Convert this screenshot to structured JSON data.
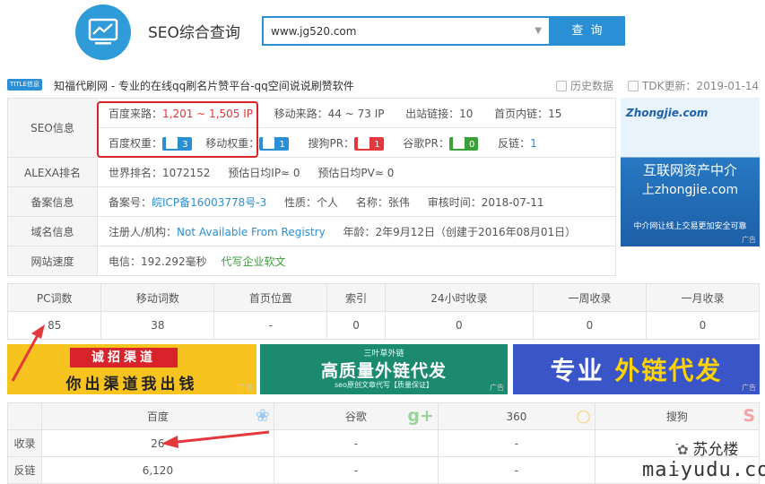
{
  "header": {
    "site_title": "SEO综合查询",
    "search_value": "www.jg520.com",
    "search_button": "查 询"
  },
  "title_bar": {
    "badge": "TITLE信息",
    "title": "知福代刷网 - 专业的在线qq刷名片赞平台-qq空间说说刷赞软件",
    "history": "历史数据",
    "tdk": "TDK更新：2019-01-14"
  },
  "seo": {
    "label": "SEO信息",
    "baidu_source_label": "百度来路：",
    "baidu_source_value": "1,201 ~ 1,505 IP",
    "mobile_source_label": "移动来路：",
    "mobile_source_value": "44 ~ 73 IP",
    "outlinks_label": "出站链接：",
    "outlinks_value": "10",
    "innerlinks_label": "首页内链：",
    "innerlinks_value": "15",
    "baidu_weight_label": "百度权重：",
    "baidu_weight_value": "3",
    "mobile_weight_label": "移动权重：",
    "mobile_weight_value": "1",
    "sogou_pr_label": "搜狗PR：",
    "sogou_pr_value": "1",
    "google_pr_label": "谷歌PR：",
    "google_pr_value": "0",
    "backlinks_label": "反链：",
    "backlinks_value": "1"
  },
  "alexa": {
    "label": "ALEXA排名",
    "world_rank": "世界排名：1072152",
    "daily_ip": "预估日均IP≈ 0",
    "daily_pv": "预估日均PV≈ 0"
  },
  "icp": {
    "label": "备案信息",
    "number_label": "备案号：",
    "number_value": "皖ICP备16003778号-3",
    "nature": "性质：个人",
    "name": "名称：张伟",
    "audit": "审核时间：2018-07-11"
  },
  "domain": {
    "label": "域名信息",
    "registrant_label": "注册人/机构：",
    "registrant_value": "Not Available From Registry",
    "age": "年龄：2年9月12日（创建于2016年08月01日）"
  },
  "speed": {
    "label": "网站速度",
    "telecom": "电信：192.292毫秒",
    "link": "代写企业软文"
  },
  "ad_zhongjie": {
    "logo": "Zhongjie.com",
    "line1": "互联网资产中介",
    "line2": "上zhongjie.com",
    "line3": "中介网让线上交易更加安全可靠",
    "mark": "广告"
  },
  "stats": {
    "headers": [
      "PC词数",
      "移动词数",
      "首页位置",
      "索引",
      "24小时收录",
      "一周收录",
      "一月收录"
    ],
    "values": [
      "85",
      "38",
      "-",
      "0",
      "0",
      "0",
      "0"
    ]
  },
  "banners": {
    "b1_top": "诚招渠道",
    "b1_bottom": "你出渠道我出钱",
    "b2_top": "三叶草外链",
    "b2_main": "高质量外链代发",
    "b2_bottom": "seo原创文章代写【质量保证】",
    "b3_a": "专业",
    "b3_b": "外链代发",
    "mark": "广告"
  },
  "engines": {
    "headers": [
      "",
      "百度",
      "谷歌",
      "360",
      "搜狗"
    ],
    "rows": [
      {
        "label": "收录",
        "values": [
          "26",
          "-",
          "-",
          "-"
        ]
      },
      {
        "label": "反链",
        "values": [
          "6,120",
          "-",
          "-",
          "-"
        ]
      }
    ]
  },
  "watermark": {
    "name": "苏允楼",
    "url": "maiyudu.com"
  },
  "colors": {
    "accent": "#2b8fd5",
    "highlight_red": "#e4393c",
    "annotation_red": "#d9232b"
  }
}
